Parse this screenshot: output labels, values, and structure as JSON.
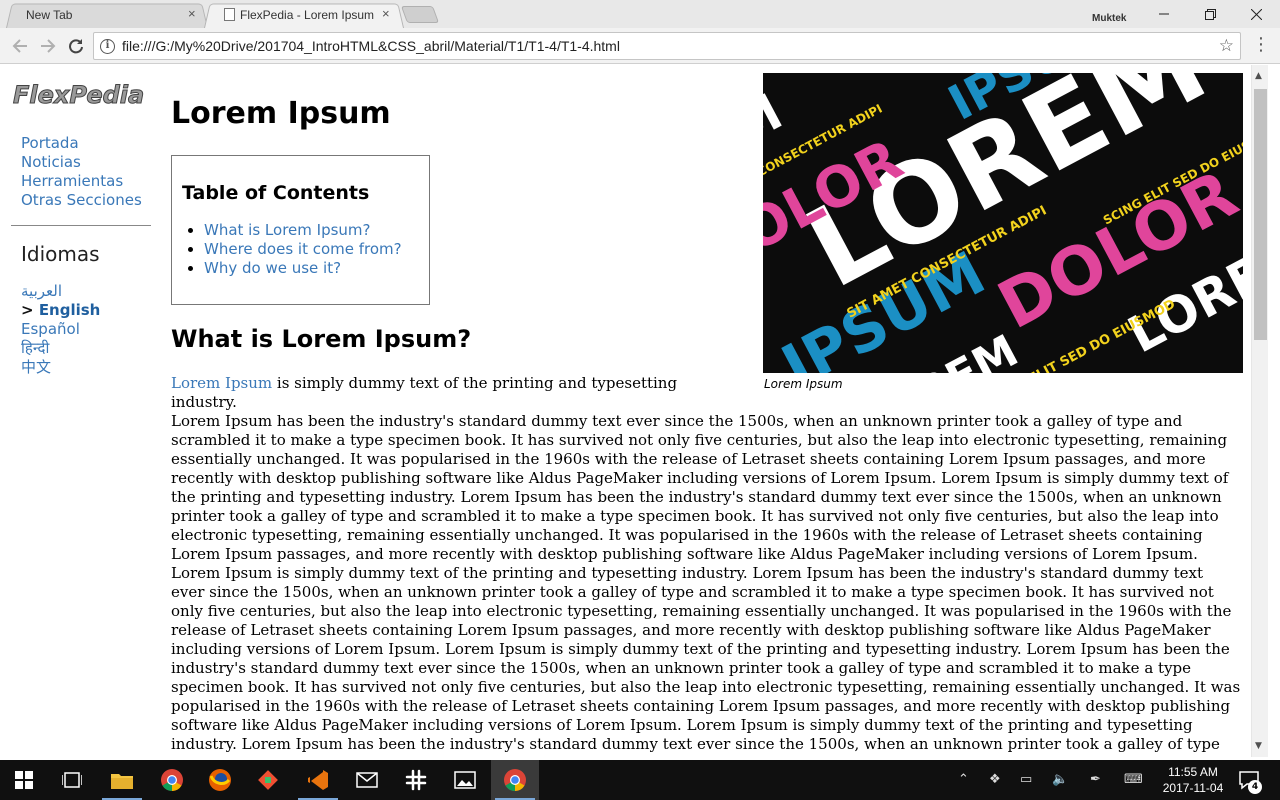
{
  "browser": {
    "tabs": [
      {
        "label": "New Tab",
        "close": "×"
      },
      {
        "label": "FlexPedia - Lorem Ipsum",
        "close": "×"
      }
    ],
    "profile_name": "Muktek",
    "url": "file:///G:/My%20Drive/201704_IntroHTML&CSS_abril/Material/T1/T1-4/T1-4.html"
  },
  "page": {
    "logo_text": "FlexPedia",
    "nav": [
      "Portada",
      "Noticias",
      "Herramientas",
      "Otras Secciones"
    ],
    "languages_heading": "Idiomas",
    "languages": [
      {
        "label": "العربية"
      },
      {
        "label": "English",
        "current": true,
        "marker": ">"
      },
      {
        "label": "Español"
      },
      {
        "label": "हिन्दी"
      },
      {
        "label": "中文"
      }
    ],
    "title": "Lorem Ipsum",
    "toc": {
      "title": "Table of Contents",
      "items": [
        "What is Lorem Ipsum?",
        "Where does it come from?",
        "Why do we use it?"
      ]
    },
    "section_heading": "What is Lorem Ipsum?",
    "figure_caption": "Lorem Ipsum",
    "figure_words": [
      "LOREM",
      "IPSUM",
      "DOLOR",
      "SIT AMET CONSECTETUR ADIPI",
      "SCING ELIT SED DO EIUSMOD"
    ],
    "body": {
      "lead_link": "Lorem Ipsum",
      "line1_rest": " is simply dummy text of the printing and typesetting industry.",
      "paragraph": "Lorem Ipsum has been the industry's standard dummy text ever since the 1500s, when an unknown printer took a galley of type and scrambled it to make a type specimen book. It has survived not only five centuries, but also the leap into electronic typesetting, remaining essentially unchanged. It was popularised in the 1960s with the release of Letraset sheets containing Lorem Ipsum passages, and more recently with desktop publishing software like Aldus PageMaker including versions of Lorem Ipsum. Lorem Ipsum is simply dummy text of the printing and typesetting industry. Lorem Ipsum has been the industry's standard dummy text ever since the 1500s, when an unknown printer took a galley of type and scrambled it to make a type specimen book. It has survived not only five centuries, but also the leap into electronic typesetting, remaining essentially unchanged. It was popularised in the 1960s with the release of Letraset sheets containing Lorem Ipsum passages, and more recently with desktop publishing software like Aldus PageMaker including versions of Lorem Ipsum. Lorem Ipsum is simply dummy text of the printing and typesetting industry. Lorem Ipsum has been the industry's standard dummy text ever since the 1500s, when an unknown printer took a galley of type and scrambled it to make a type specimen book. It has survived not only five centuries, but also the leap into electronic typesetting, remaining essentially unchanged. It was popularised in the 1960s with the release of Letraset sheets containing Lorem Ipsum passages, and more recently with desktop publishing software like Aldus PageMaker including versions of Lorem Ipsum. Lorem Ipsum is simply dummy text of the printing and typesetting industry. Lorem Ipsum has been the industry's standard dummy text ever since the 1500s, when an unknown printer took a galley of type and scrambled it to make a type specimen book. It has survived not only five centuries, but also the leap into electronic typesetting, remaining essentially unchanged. It was popularised in the 1960s with the release of Letraset sheets containing Lorem Ipsum passages, and more recently with desktop publishing software like Aldus PageMaker including versions of Lorem Ipsum. Lorem Ipsum is simply dummy text of the printing and typesetting industry. Lorem Ipsum has been the industry's standard dummy text ever since the 1500s, when an unknown printer took a galley of type and scrambled it to make a type specimen book. It has survived not only five centuries, but also the leap into electronic typesetting, remaining essentially unchanged. It was popularised in the 1960s with the release of Letraset sheets containing Lorem Ipsum passages, and more recently with"
    }
  },
  "taskbar": {
    "time": "11:55 AM",
    "date": "2017-11-04",
    "notification_count": "4",
    "apps": [
      "task-view",
      "file-explorer",
      "chrome",
      "firefox",
      "git",
      "visual-studio",
      "mail",
      "slack",
      "photos",
      "chrome-active"
    ]
  },
  "colors": {
    "link": "#3a78b8",
    "figure_pink": "#e0459b",
    "figure_blue": "#1b8fc4",
    "figure_yellow": "#f2d21d"
  }
}
